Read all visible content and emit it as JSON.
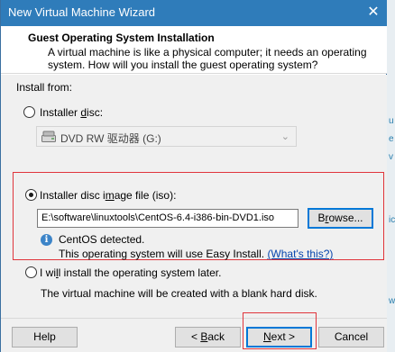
{
  "window": {
    "title": "New Virtual Machine Wizard",
    "close_glyph": "✕"
  },
  "header": {
    "title": "Guest Operating System Installation",
    "description_line1": "A virtual machine is like a physical computer; it needs an operating",
    "description_line2": "system. How will you install the guest operating system?"
  },
  "install_from": {
    "label": "Install from:",
    "installer_disc": {
      "label_pre": "Installer ",
      "label_accel": "d",
      "label_post": "isc:",
      "selected": false,
      "drive": "DVD RW 驱动器 (G:)"
    },
    "iso": {
      "label_pre": "Installer disc i",
      "label_accel": "m",
      "label_post": "age file (iso):",
      "selected": true,
      "path": "E:\\software\\linuxtools\\CentOS-6.4-i386-bin-DVD1.iso",
      "browse_label_pre": "B",
      "browse_label_accel": "r",
      "browse_label_post": "owse...",
      "detected": "CentOS detected.",
      "easy_install_note": "This operating system will use Easy Install.",
      "whats_this": "(What's this?)"
    },
    "later": {
      "label_pre": "I wi",
      "label_accel": "l",
      "label_post": "l install the operating system later.",
      "selected": false,
      "description": "The virtual machine will be created with a blank hard disk."
    }
  },
  "footer": {
    "help": "Help",
    "back_accel": "B",
    "back_post": "ack",
    "back_pre": "< ",
    "next_accel": "N",
    "next_post": "ext >",
    "cancel": "Cancel"
  },
  "colors": {
    "titlebar": "#2f7cba",
    "highlight_box": "#e0353b",
    "link": "#0645ad"
  }
}
